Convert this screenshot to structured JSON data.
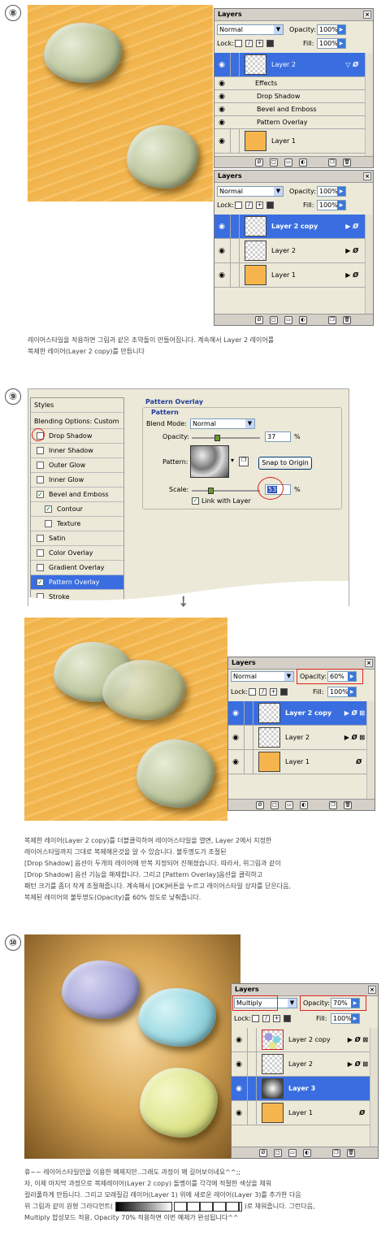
{
  "section8": {
    "step": "⑧",
    "layers1": {
      "title": "Layers",
      "blend_mode": "Normal",
      "opacity_label": "Opacity:",
      "opacity_value": "100%",
      "lock_label": "Lock:",
      "fill_label": "Fill:",
      "fill_value": "100%",
      "layer2": "Layer 2",
      "effects_label": "Effects",
      "effect1": "Drop Shadow",
      "effect2": "Bevel and Emboss",
      "effect3": "Pattern Overlay",
      "layer1": "Layer 1"
    },
    "layers2": {
      "title": "Layers",
      "blend_mode": "Normal",
      "opacity_label": "Opacity:",
      "opacity_value": "100%",
      "lock_label": "Lock:",
      "fill_label": "Fill:",
      "fill_value": "100%",
      "layer_a": "Layer 2 copy",
      "layer_b": "Layer 2",
      "layer_c": "Layer 1"
    },
    "text_lines": [
      "레이어스타일을 적용하면 그림과 같은 조약돌이 만들어집니다. 계속해서 Layer 2 레이어를",
      "복제한 레이어(Layer 2 copy)를 만듭니다"
    ]
  },
  "section9": {
    "step": "⑨",
    "styles_header": "Styles",
    "blending": "Blending Options: Custom",
    "style_items": [
      {
        "label": "Drop Shadow",
        "checked": false
      },
      {
        "label": "Inner Shadow",
        "checked": false
      },
      {
        "label": "Outer Glow",
        "checked": false
      },
      {
        "label": "Inner Glow",
        "checked": false
      },
      {
        "label": "Bevel and Emboss",
        "checked": true
      },
      {
        "label": "Contour",
        "checked": true
      },
      {
        "label": "Texture",
        "checked": false
      },
      {
        "label": "Satin",
        "checked": false
      },
      {
        "label": "Color Overlay",
        "checked": false
      },
      {
        "label": "Gradient Overlay",
        "checked": false
      },
      {
        "label": "Pattern Overlay",
        "checked": true
      },
      {
        "label": "Stroke",
        "checked": false
      }
    ],
    "po_title": "Pattern Overlay",
    "po_sub": "Pattern",
    "blend_mode_label": "Blend Mode:",
    "blend_mode_value": "Normal",
    "opacity_label": "Opacity:",
    "opacity_value": "37",
    "percent": "%",
    "pattern_label": "Pattern:",
    "snap_button": "Snap to Origin",
    "scale_label": "Scale:",
    "scale_value": "53",
    "link_label": "Link with Layer",
    "down_arrow": "➘",
    "layers3": {
      "title": "Layers",
      "blend_mode": "Normal",
      "opacity_label": "Opacity:",
      "opacity_value": "60%",
      "lock_label": "Lock:",
      "fill_label": "Fill:",
      "fill_value": "100%",
      "layer_a": "Layer 2 copy",
      "layer_b": "Layer 2",
      "layer_c": "Layer 1"
    },
    "text_lines": [
      "복제한 레이어(Layer 2 copy)를 더블클릭하여 레이어스타일을 열면, Layer 2에서 지정한",
      "레이어스타일까지 그대로 복제해온것을 알 수 있습니다. 불투명도가 조절된",
      "[Drop Shadow] 옵션이 두개의 레이어에 반복 지정되어 진해졌습니다. 따라서, 위그림과 같이",
      "[Drop Shadow] 옵션 기능을 해제합니다. 그리고 [Pattern Overlay]옵션을 클릭하고",
      "패턴 크기를 좀더 작게 조절해줍니다. 계속해서 [OK]버튼을 누르고 레이어스타일 상자를 닫은다음,",
      "복제된 레이어의 불투명도(Opacity)를 60% 정도로 낮춰줍니다."
    ]
  },
  "section10": {
    "step": "⑩",
    "layers4": {
      "title": "Layers",
      "blend_mode": "Multiply",
      "opacity_label": "Opacity:",
      "opacity_value": "70%",
      "lock_label": "Lock:",
      "fill_label": "Fill:",
      "fill_value": "100%",
      "layer_a": "Layer 2 copy",
      "layer_b": "Layer 2",
      "layer_c": "Layer 3",
      "layer_d": "Layer 1"
    },
    "text_lines": [
      "휴~~ 레이어스타일만을 이용한 예제지만..그래도 과정이 꽤 길어보이네요^^;;",
      "자, 이제 마지막 과정으로 복제레이어(Layer 2 copy) 돌멩이를 각각에 적절한 색상을 채워",
      "컬러풀하게 만듭니다. 그리고 모래질감 레이어(Layer 1) 위에 새로운 레이어(Layer 3)를 추가한 다음",
      "Multiply 합성모드 적용, Opacity 70% 적용하면 이번 예제가 완성됩니다^^"
    ],
    "line4_prefix": "위 그림과 같이 원형 그라디언트(",
    "line4_suffix": ")로 채워줍니다. 그런다음,"
  }
}
